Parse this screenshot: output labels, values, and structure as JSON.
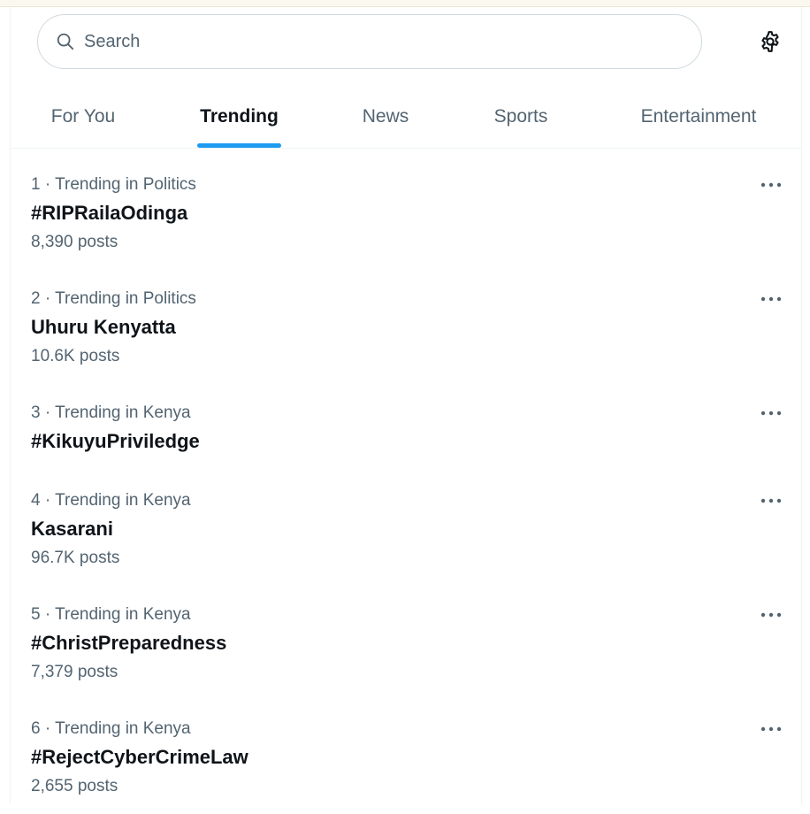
{
  "search": {
    "placeholder": "Search"
  },
  "icons": {
    "search": "search-icon",
    "settings": "gear-icon",
    "more": "more-dots-icon"
  },
  "colors": {
    "accent": "#1d9bf0",
    "primary_text": "#0f1419",
    "secondary_text": "#536471",
    "border": "#cfd9de"
  },
  "tabs": [
    {
      "label": "For You",
      "active": false
    },
    {
      "label": "Trending",
      "active": true
    },
    {
      "label": "News",
      "active": false
    },
    {
      "label": "Sports",
      "active": false
    },
    {
      "label": "Entertainment",
      "active": false
    }
  ],
  "trends": [
    {
      "rank": "1",
      "category": "Trending in Politics",
      "name": "#RIPRailaOdinga",
      "posts": "8,390 posts"
    },
    {
      "rank": "2",
      "category": "Trending in Politics",
      "name": "Uhuru Kenyatta",
      "posts": "10.6K posts"
    },
    {
      "rank": "3",
      "category": "Trending in Kenya",
      "name": "#KikuyuPriviledge",
      "posts": ""
    },
    {
      "rank": "4",
      "category": "Trending in Kenya",
      "name": "Kasarani",
      "posts": "96.7K posts"
    },
    {
      "rank": "5",
      "category": "Trending in Kenya",
      "name": "#ChristPreparedness",
      "posts": "7,379 posts"
    },
    {
      "rank": "6",
      "category": "Trending in Kenya",
      "name": "#RejectCyberCrimeLaw",
      "posts": "2,655 posts"
    }
  ]
}
